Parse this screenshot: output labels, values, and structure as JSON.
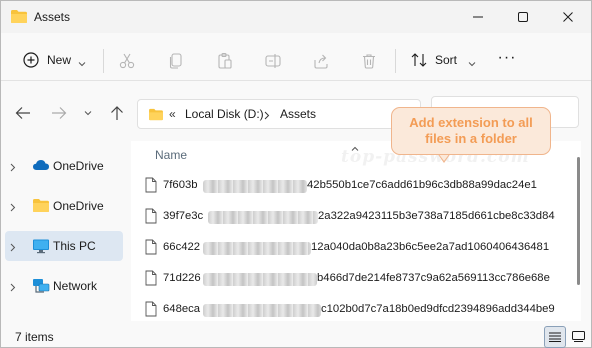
{
  "window": {
    "title": "Assets"
  },
  "toolbar": {
    "new_label": "New",
    "sort_label": "Sort",
    "more_label": "···"
  },
  "address": {
    "overflow": "«",
    "part1": "Local Disk (D:)",
    "part2": "Assets"
  },
  "callout": {
    "line1": "Add extension to all",
    "line2": "files in a folder"
  },
  "sidebar": {
    "items": [
      {
        "label": "OneDrive",
        "icon": "cloud-icon"
      },
      {
        "label": "OneDrive",
        "icon": "folder-icon"
      },
      {
        "label": "This PC",
        "icon": "monitor-icon"
      },
      {
        "label": "Network",
        "icon": "network-icon"
      }
    ]
  },
  "content": {
    "column_name": "Name",
    "watermark": "top-password.com",
    "files": [
      {
        "prefix": "7f603b",
        "suffix": "42b550b1ce7c6add61b96c3db88a99dac24e1"
      },
      {
        "prefix": "39f7e3c",
        "suffix": "2a322a9423115b3e738a7185d661cbe8c33d84"
      },
      {
        "prefix": "66c422",
        "suffix": "12a040da0b8a23b6c5ee2a7ad1060406436481"
      },
      {
        "prefix": "71d226",
        "suffix": "b466d7de214fe8737c9a62a569113cc786e68e"
      },
      {
        "prefix": "648eca",
        "suffix": "c102b0d7c7a18b0ed9dfcd2394896add344be9"
      }
    ]
  },
  "status": {
    "count": "7 items"
  },
  "colors": {
    "accent": "#0067c0",
    "callout_text": "#f39c55",
    "callout_bg": "#fbe9da",
    "selection": "#dde7f2"
  }
}
